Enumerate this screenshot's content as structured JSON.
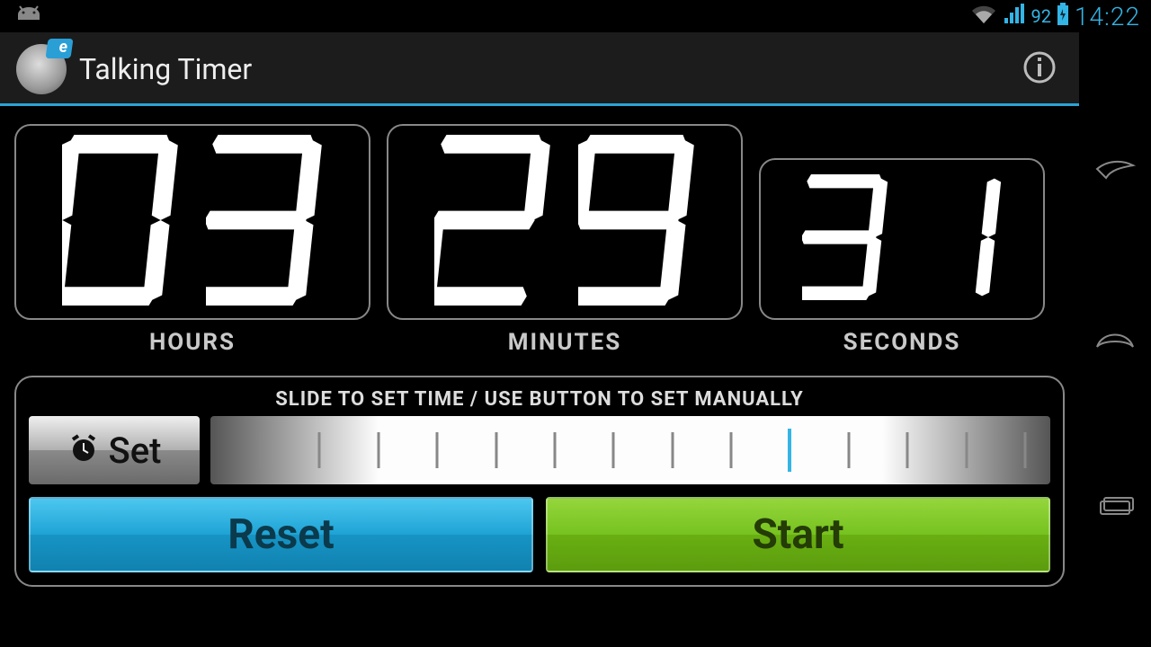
{
  "status": {
    "battery": "92",
    "clock": "14:22"
  },
  "app": {
    "title": "Talking Timer"
  },
  "timer": {
    "hours": "03",
    "minutes": "29",
    "seconds": "31",
    "labels": {
      "hours": "HOURS",
      "minutes": "MINUTES",
      "seconds": "SECONDS"
    }
  },
  "controls": {
    "instruction": "SLIDE TO SET TIME / USE BUTTON TO SET MANUALLY",
    "set_label": "Set",
    "slider": {
      "ticks": 15,
      "active_tick": 9
    },
    "reset_label": "Reset",
    "start_label": "Start"
  },
  "colors": {
    "accent": "#33B5E5",
    "reset": "#1ea3d5",
    "start": "#76c21f"
  }
}
